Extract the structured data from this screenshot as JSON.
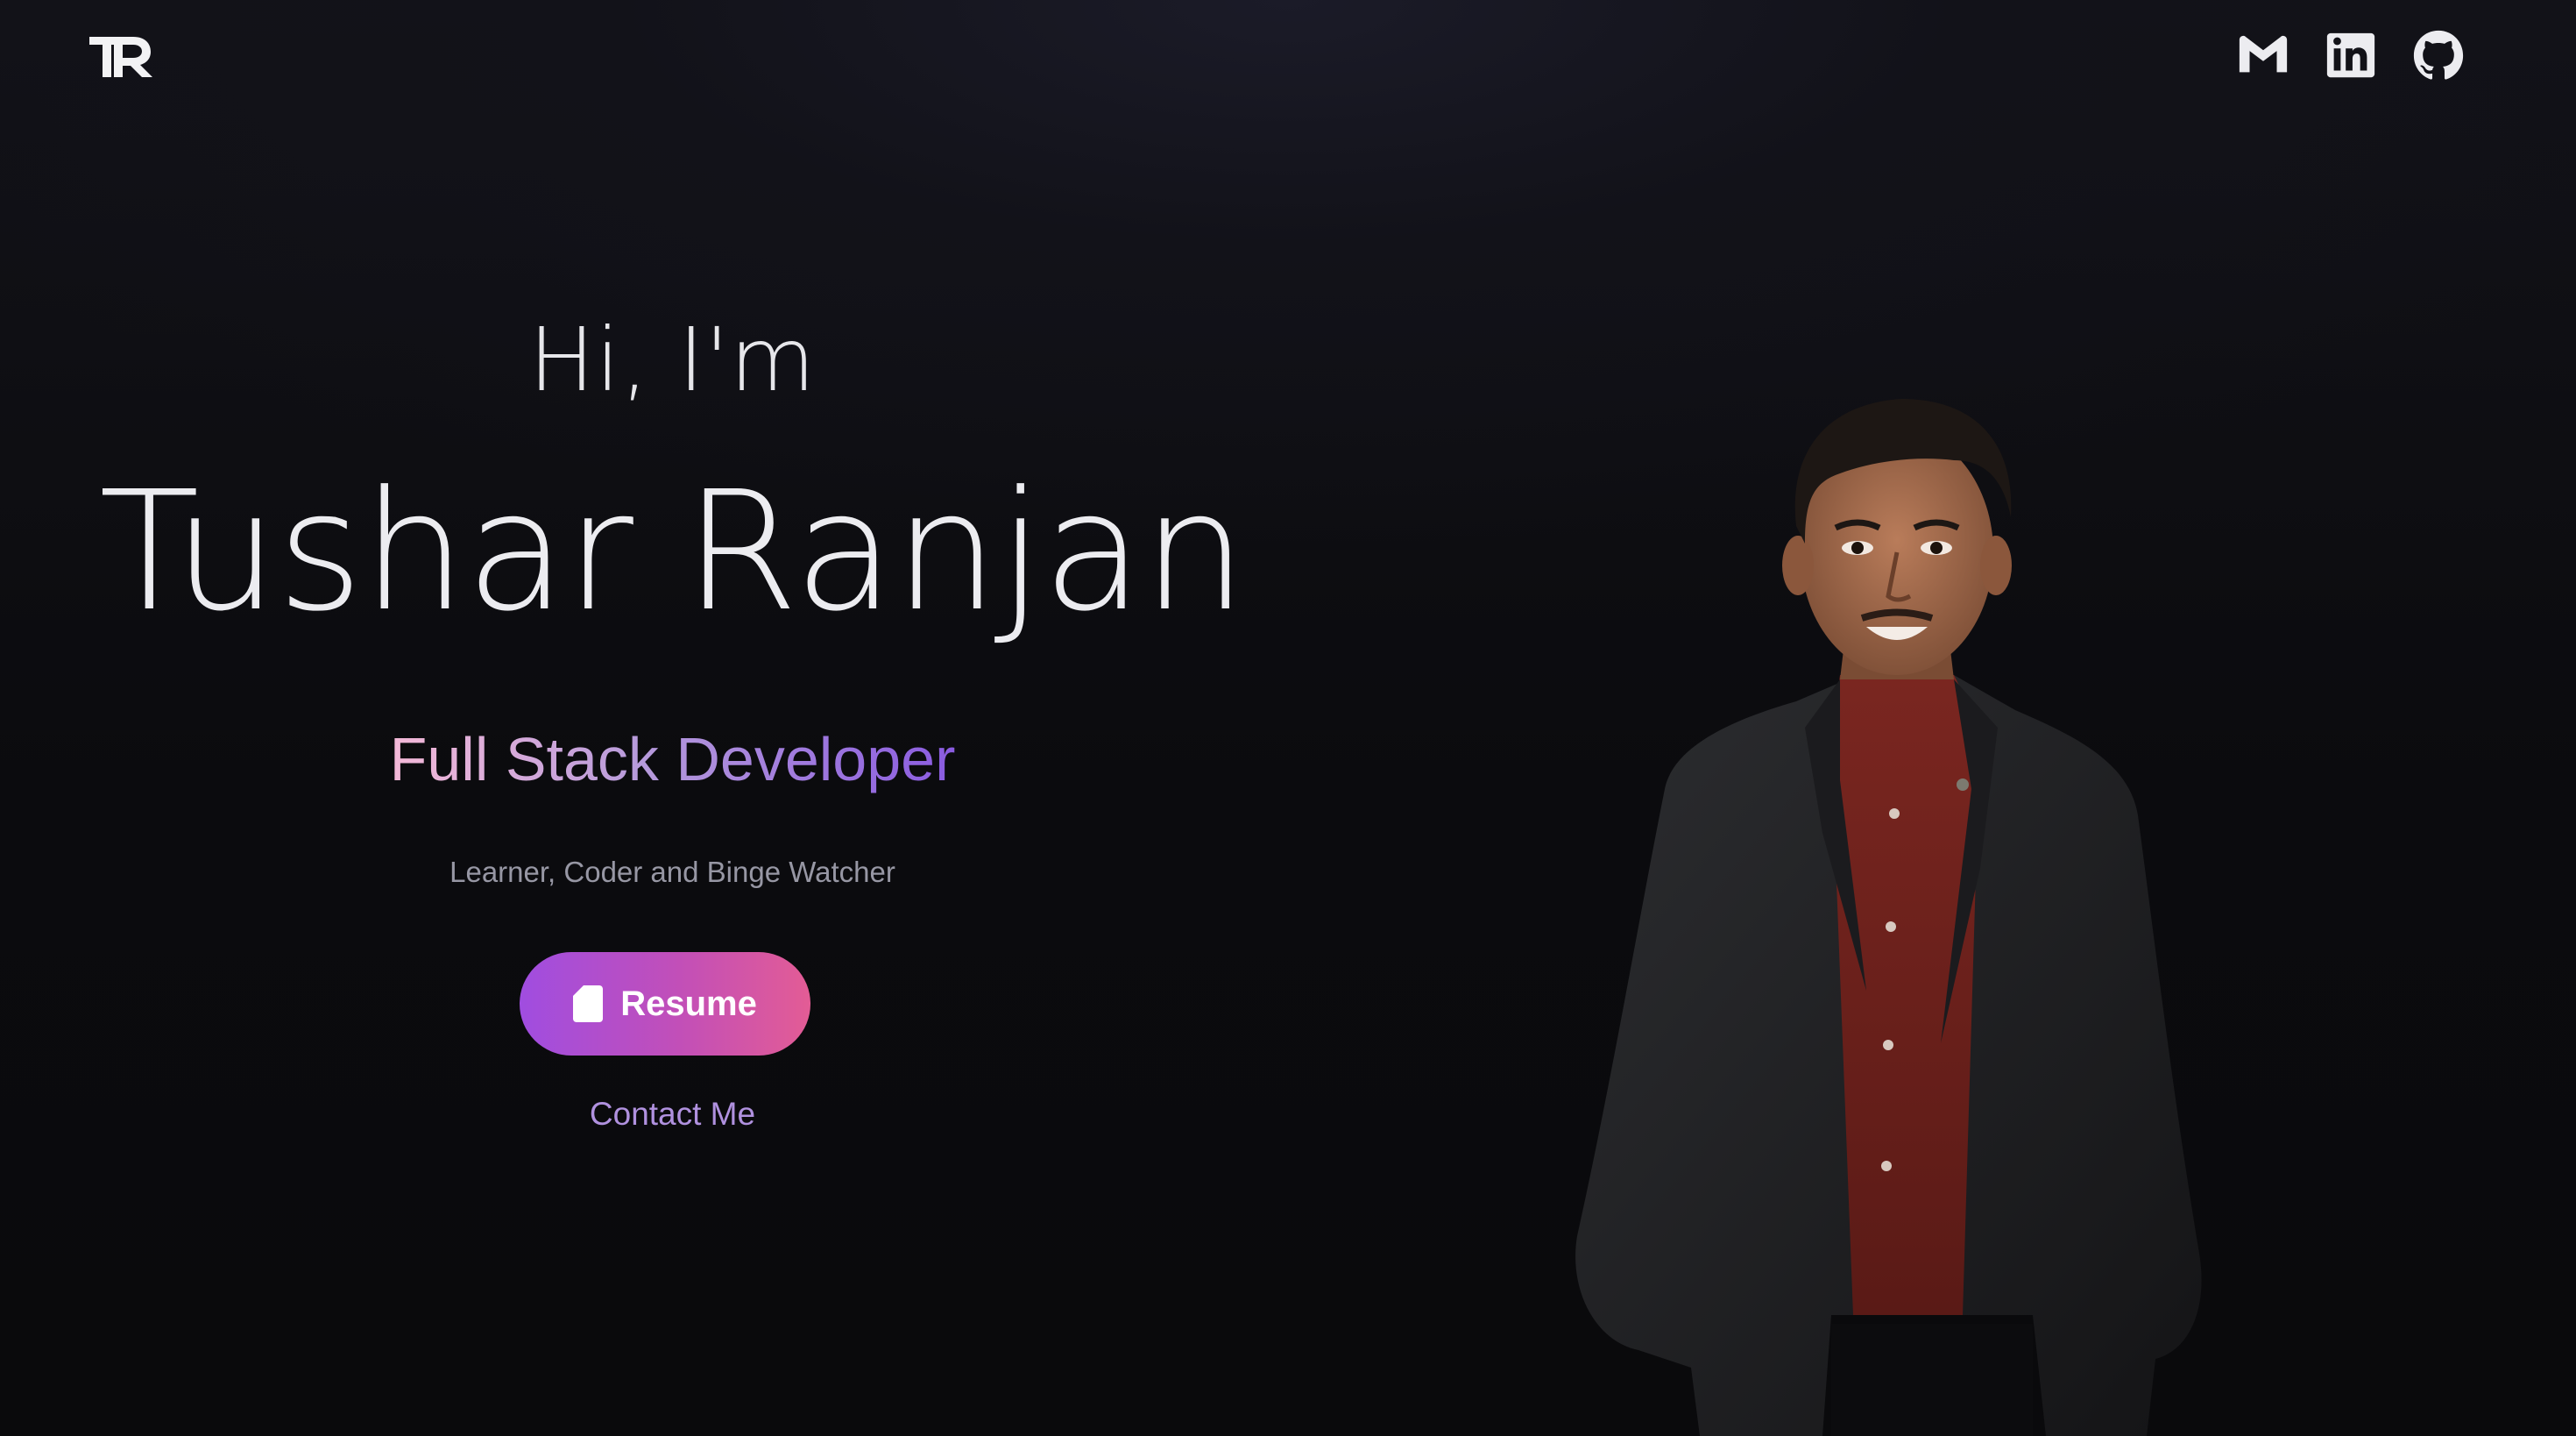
{
  "header": {
    "logo_text": "TR",
    "social": [
      {
        "name": "gmail",
        "icon": "gmail-icon"
      },
      {
        "name": "linkedin",
        "icon": "linkedin-icon"
      },
      {
        "name": "github",
        "icon": "github-icon"
      }
    ]
  },
  "hero": {
    "greeting": "Hi, I'm",
    "name": "Tushar Ranjan",
    "role": "Full Stack Developer",
    "tagline": "Learner, Coder and Binge Watcher",
    "resume_label": "Resume",
    "contact_label": "Contact Me"
  },
  "colors": {
    "background": "#0a0a0c",
    "button_gradient_start": "#a04de0",
    "button_gradient_end": "#e35c95",
    "role_gradient_start": "#f4b9d8",
    "role_gradient_end": "#8a5be0",
    "contact": "#b091df"
  }
}
